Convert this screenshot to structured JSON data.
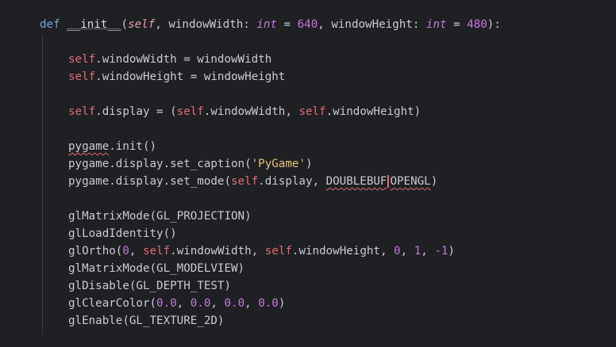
{
  "code": {
    "l1": {
      "kw": "def",
      "name": "__init__",
      "p1": "(",
      "self": "self",
      "c1": ", windowWidth: ",
      "t1": "int",
      "eq1": " = ",
      "n1": "640",
      "c2": ", windowHeight: ",
      "t2": "int",
      "eq2": " = ",
      "n2": "480",
      "end": "):"
    },
    "l2": {
      "self": "self",
      "rest": ".windowWidth = windowWidth"
    },
    "l3": {
      "self": "self",
      "rest": ".windowHeight = windowHeight"
    },
    "l4": {
      "self": "self",
      "a": ".display = (",
      "self2": "self",
      "b": ".windowWidth, ",
      "self3": "self",
      "c": ".windowHeight)"
    },
    "l5": {
      "mod": "pygame",
      "rest": ".init()"
    },
    "l6": {
      "mod": "pygame",
      "a": ".display.set_caption(",
      "str": "'PyGame'",
      "b": ")"
    },
    "l7": {
      "mod": "pygame",
      "a": ".display.set_mode(",
      "self": "self",
      "b": ".display, ",
      "c1": "DOUBLEBUF",
      "c2": "OPENGL",
      "end": ")"
    },
    "l8": {
      "text": "glMatrixMode(GL_PROJECTION)"
    },
    "l9": {
      "text": "glLoadIdentity()"
    },
    "l10": {
      "a": "glOrtho(",
      "n0": "0",
      "b": ", ",
      "self1": "self",
      "c": ".windowWidth, ",
      "self2": "self",
      "d": ".windowHeight, ",
      "n1": "0",
      "e": ", ",
      "n2": "1",
      "f": ", ",
      "n3": "-1",
      "end": ")"
    },
    "l11": {
      "text": "glMatrixMode(GL_MODELVIEW)"
    },
    "l12": {
      "text": "glDisable(GL_DEPTH_TEST)"
    },
    "l13": {
      "a": "glClearColor(",
      "n1": "0.0",
      "s1": ", ",
      "n2": "0.0",
      "s2": ", ",
      "n3": "0.0",
      "s3": ", ",
      "n4": "0.0",
      "end": ")"
    },
    "l14": {
      "text": "glEnable(GL_TEXTURE_2D)"
    }
  }
}
